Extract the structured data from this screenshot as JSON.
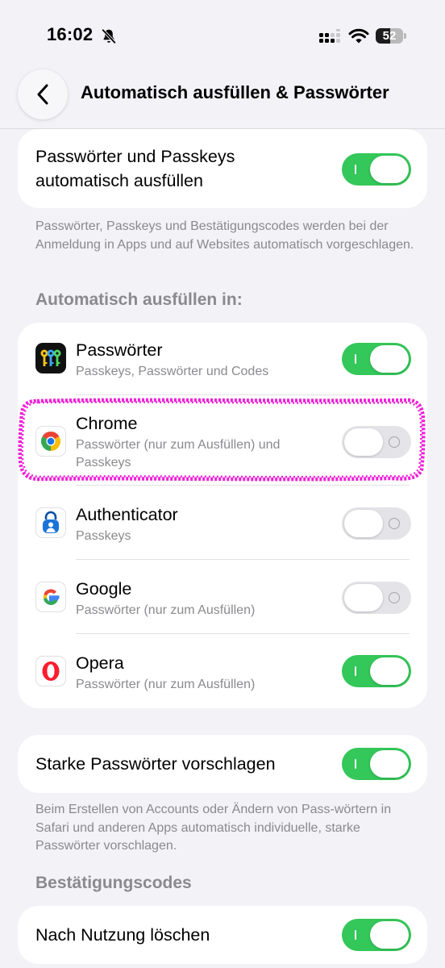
{
  "status": {
    "time": "16:02",
    "battery": "52",
    "battery_level": 0.52
  },
  "nav": {
    "title": "Automatisch ausfüllen & Passwörter"
  },
  "autofill": {
    "title_line1": "Passwörter und Passkeys",
    "title_line2": "automatisch ausfüllen",
    "enabled": true,
    "footnote": "Passwörter, Passkeys und Bestätigungscodes werden bei der Anmeldung in Apps und auf Websites automatisch vorgeschlagen."
  },
  "providers": {
    "header": "Automatisch ausfüllen in:",
    "items": [
      {
        "name": "Passwörter",
        "subtitle": "Passkeys, Passwörter und Codes",
        "enabled": true,
        "icon": "passwords-keys-icon"
      },
      {
        "name": "Chrome",
        "subtitle_line1": "Passwörter (nur zum Ausfüllen) und",
        "subtitle_line2": "Passkeys",
        "enabled": false,
        "icon": "chrome-icon"
      },
      {
        "name": "Authenticator",
        "subtitle": "Passkeys",
        "enabled": false,
        "icon": "authenticator-lock-icon"
      },
      {
        "name": "Google",
        "subtitle": "Passwörter (nur zum Ausfüllen)",
        "enabled": false,
        "icon": "google-g-icon"
      },
      {
        "name": "Opera",
        "subtitle": "Passwörter (nur zum Ausfüllen)",
        "enabled": true,
        "icon": "opera-o-icon"
      }
    ]
  },
  "strong": {
    "title": "Starke Passwörter vorschlagen",
    "enabled": true,
    "footnote": "Beim Erstellen von Accounts oder Ändern von Pass-wörtern in Safari und anderen Apps automatisch individuelle, starke Passwörter vorschlagen."
  },
  "codes": {
    "header": "Bestätigungscodes",
    "title": "Nach Nutzung löschen",
    "enabled": true
  },
  "colors": {
    "toggle_on": "#34c759",
    "toggle_off": "#e4e4e8",
    "highlight": "#f01fd8",
    "background": "#f2f2f7"
  }
}
